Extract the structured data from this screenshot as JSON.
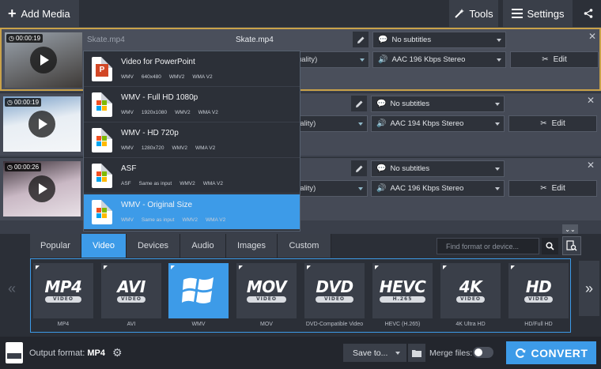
{
  "toolbar": {
    "add_media": "Add Media",
    "tools": "Tools",
    "settings": "Settings"
  },
  "files": [
    {
      "time": "00:00:19",
      "name_left": "Skate.mp4",
      "name_right": "Skate.mp4",
      "quality_fragment": "uality)",
      "subtitles": "No subtitles",
      "audio": "AAC 196 Kbps Stereo",
      "edit_label": "Edit"
    },
    {
      "time": "00:00:19",
      "quality_fragment": "uality)",
      "subtitles": "No subtitles",
      "audio": "AAC 194 Kbps Stereo",
      "edit_label": "Edit"
    },
    {
      "time": "00:00:26",
      "quality_fragment": "uality)",
      "subtitles": "No subtitles",
      "audio": "AAC 196 Kbps Stereo",
      "edit_label": "Edit"
    }
  ],
  "preset_dropdown": [
    {
      "title": "Video for PowerPoint",
      "specs": [
        "WMV",
        "640x480",
        "WMV2",
        "WMA V2"
      ]
    },
    {
      "title": "WMV - Full HD 1080p",
      "specs": [
        "WMV",
        "1920x1080",
        "WMV2",
        "WMA V2"
      ]
    },
    {
      "title": "WMV - HD 720p",
      "specs": [
        "WMV",
        "1280x720",
        "WMV2",
        "WMA V2"
      ]
    },
    {
      "title": "ASF",
      "specs": [
        "ASF",
        "Same as input",
        "WMV2",
        "WMA V2"
      ]
    },
    {
      "title": "WMV - Original Size",
      "specs": [
        "WMV",
        "Same as input",
        "WMV2",
        "WMA V2"
      ]
    }
  ],
  "tabs": [
    "Popular",
    "Video",
    "Devices",
    "Audio",
    "Images",
    "Custom"
  ],
  "active_tab": "Video",
  "search": {
    "placeholder": "Find format or device..."
  },
  "formats": [
    {
      "logo": "MP4",
      "sub": "VIDEO",
      "label": "MP4"
    },
    {
      "logo": "AVI",
      "sub": "VIDEO",
      "label": "AVI"
    },
    {
      "logo": "",
      "sub": "",
      "label": "WMV"
    },
    {
      "logo": "MOV",
      "sub": "VIDEO",
      "label": "MOV"
    },
    {
      "logo": "DVD",
      "sub": "VIDEO",
      "label": "DVD-Compatible Video"
    },
    {
      "logo": "HEVC",
      "sub": "H.265",
      "label": "HEVC (H.265)"
    },
    {
      "logo": "4K",
      "sub": "VIDEO",
      "label": "4K Ultra HD"
    },
    {
      "logo": "HD",
      "sub": "VIDEO",
      "label": "HD/Full HD"
    }
  ],
  "bottom": {
    "output_label": "Output format:",
    "output_value": "MP4",
    "save_to": "Save to...",
    "merge_label": "Merge files:",
    "convert": "CONVERT"
  },
  "colors": {
    "accent": "#3d9be8",
    "selected_border": "#c9a24a"
  }
}
